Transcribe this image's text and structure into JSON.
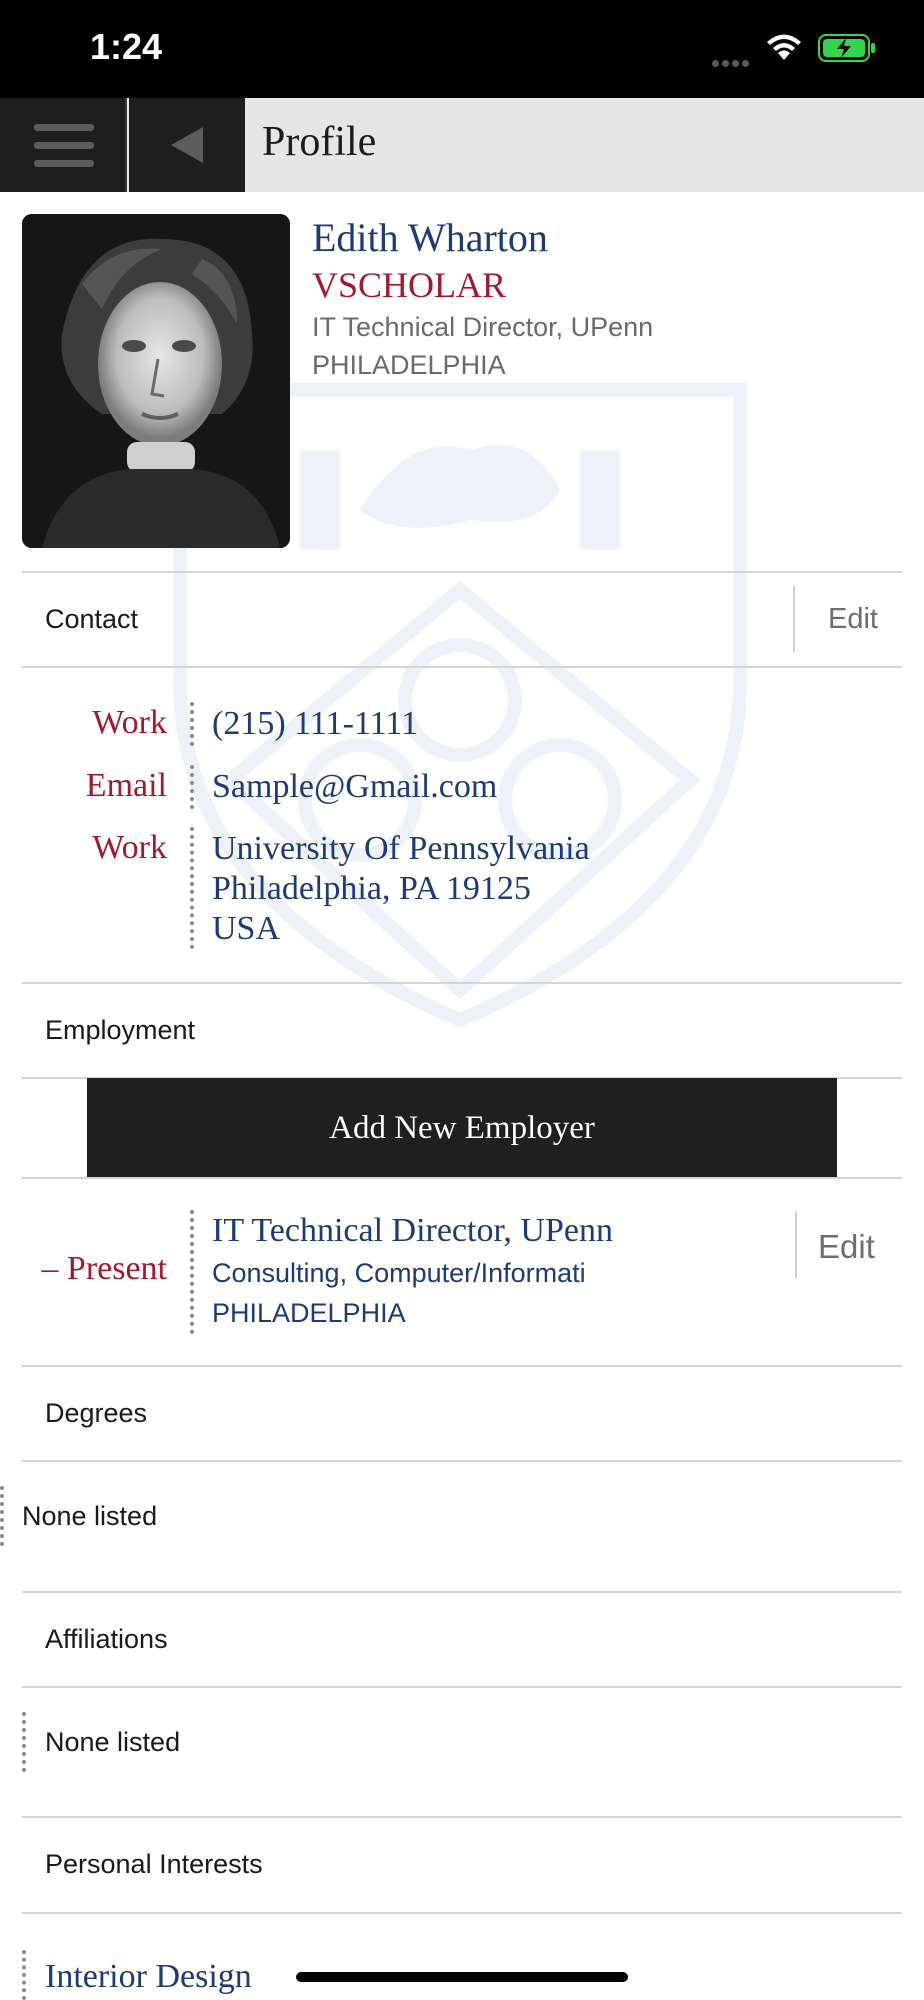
{
  "status": {
    "time": "1:24"
  },
  "nav": {
    "title": "Profile"
  },
  "profile": {
    "name": "Edith Wharton",
    "role": "VSCHOLAR",
    "title": "IT Technical Director, UPenn",
    "city": "PHILADELPHIA"
  },
  "contact": {
    "header": "Contact",
    "edit_label": "Edit",
    "rows": [
      {
        "label": "Work",
        "value": "(215) 111-1111"
      },
      {
        "label": "Email",
        "value": "Sample@Gmail.com"
      },
      {
        "label": "Work",
        "lines": [
          "University Of Pennsylvania",
          "Philadelphia, PA 19125",
          "USA"
        ]
      }
    ]
  },
  "employment": {
    "header": "Employment",
    "add_button_label": "Add New Employer",
    "entry": {
      "period": "– Present",
      "title": "IT Technical Director, UPenn",
      "industry": "Consulting, Computer/Informati",
      "city": "PHILADELPHIA",
      "edit_label": "Edit"
    }
  },
  "degrees": {
    "header": "Degrees",
    "empty_text": "None listed"
  },
  "affiliations": {
    "header": "Affiliations",
    "empty_text": "None listed"
  },
  "interests": {
    "header": "Personal Interests",
    "items": [
      "Interior Design"
    ]
  },
  "colors": {
    "brand_blue": "#1d3a7a",
    "brand_red": "#a4192e",
    "nav_dark": "#1e1e1e",
    "battery_green": "#32d74b"
  }
}
